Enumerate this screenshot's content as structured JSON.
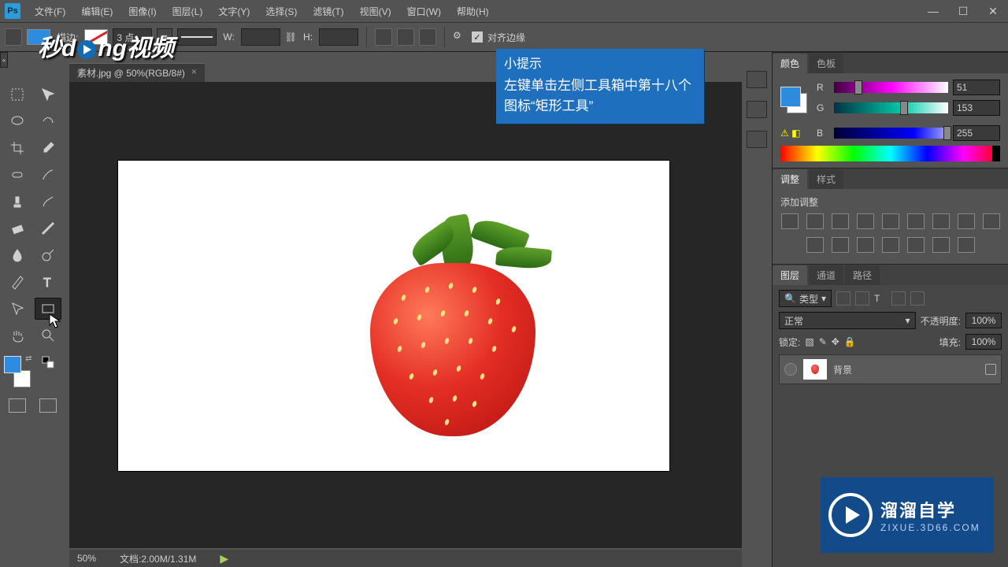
{
  "menu": {
    "items": [
      "文件(F)",
      "编辑(E)",
      "图像(I)",
      "图层(L)",
      "文字(Y)",
      "选择(S)",
      "滤镜(T)",
      "视图(V)",
      "窗口(W)",
      "帮助(H)"
    ]
  },
  "optionsbar": {
    "stroke_label": "描边:",
    "stroke_width": "3 点",
    "w_label": "W:",
    "h_label": "H:",
    "align_label": "对齐边缘"
  },
  "brand_text": "秒d  ng视频",
  "tab": {
    "title": "素材.jpg @ 50%(RGB/8#)",
    "close": "×"
  },
  "tooltip": {
    "title": "小提示",
    "body": "左键单击左侧工具箱中第十八个图标“矩形工具”"
  },
  "panels": {
    "color": {
      "tab_color": "颜色",
      "tab_swatch": "色板",
      "r_label": "R",
      "g_label": "G",
      "b_label": "B",
      "r_val": "51",
      "g_val": "153",
      "b_val": "255"
    },
    "adjust": {
      "tab_adjust": "调整",
      "tab_style": "样式",
      "heading": "添加调整"
    },
    "layers": {
      "tab_layers": "图层",
      "tab_channels": "通道",
      "tab_paths": "路径",
      "kind": "类型",
      "blend": "正常",
      "opacity_label": "不透明度:",
      "opacity_val": "100%",
      "lock_label": "锁定:",
      "fill_label": "填充:",
      "fill_val": "100%",
      "layer_name": "背景"
    }
  },
  "watermark": {
    "line1": "溜溜自学",
    "line2": "ZIXUE.3D66.COM"
  },
  "status": {
    "zoom": "50%",
    "doc": "文档:2.00M/1.31M"
  },
  "colors": {
    "accent": "#2e8cde"
  }
}
